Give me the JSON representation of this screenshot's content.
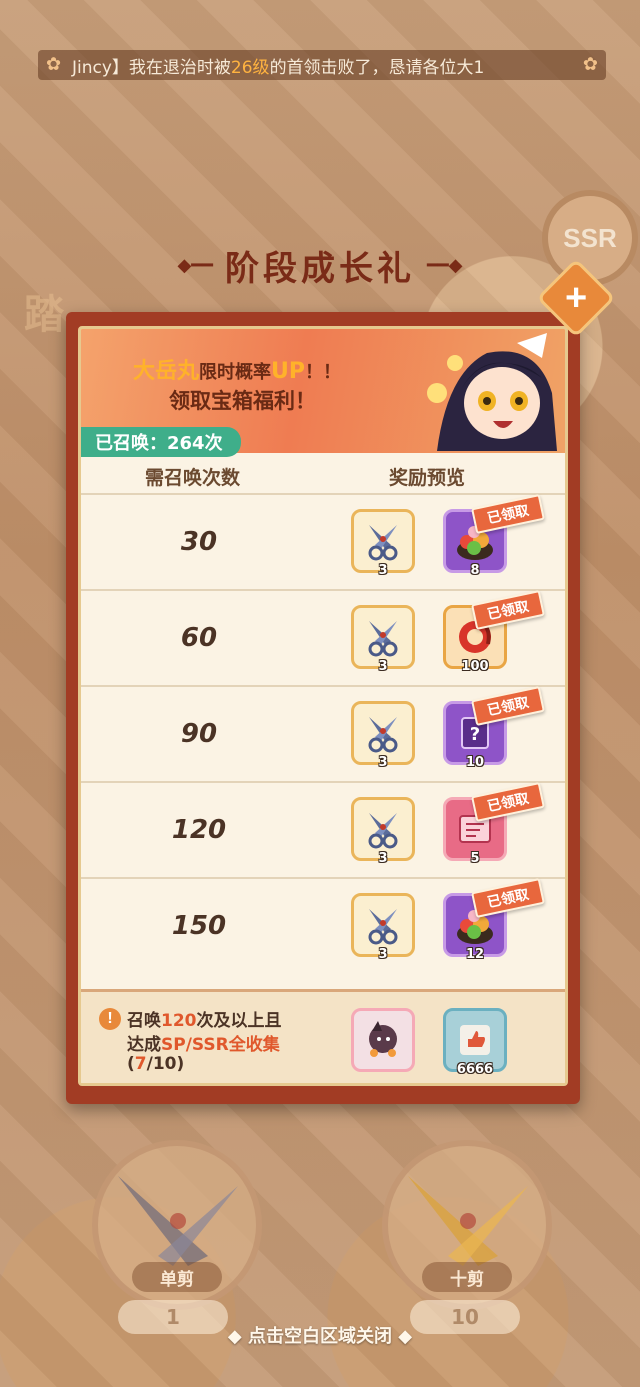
{
  "marquee": {
    "prefix": "Jincy】我在退治时被",
    "level": "26级",
    "suffix": "的首领击败了，恳请各位大1"
  },
  "background": {
    "title": "踏",
    "ssr_badge": "SSR"
  },
  "dialog": {
    "title": "阶段成长礼",
    "banner": {
      "name": "大岳丸",
      "limited_text": "限时概率",
      "up": "UP",
      "exclaim": "！！",
      "line2": "领取宝箱福利！"
    },
    "summon_count_label": "已召唤：264次",
    "columns": {
      "requirement": "需召唤次数",
      "rewards": "奖励预览"
    },
    "claimed_label": "已领取",
    "rows": [
      {
        "count": "30",
        "reward1_qty": "3",
        "reward2_qty": "8"
      },
      {
        "count": "60",
        "reward1_qty": "3",
        "reward2_qty": "100"
      },
      {
        "count": "90",
        "reward1_qty": "3",
        "reward2_qty": "10"
      },
      {
        "count": "120",
        "reward1_qty": "3",
        "reward2_qty": "5"
      },
      {
        "count": "150",
        "reward1_qty": "3",
        "reward2_qty": "12"
      }
    ],
    "bonus": {
      "line1_prefix": "召唤",
      "line1_num": "120",
      "line1_suffix": "次及以上且",
      "line2_prefix": "达成",
      "line2_hl": "SP/SSR全收集",
      "progress_open": "(",
      "progress_current": "7",
      "progress_rest": "/10)",
      "reward2_qty": "6666"
    }
  },
  "controls": {
    "single_label": "单剪",
    "single_count": "1",
    "ten_label": "十剪",
    "ten_count": "10"
  },
  "close_hint": "◆ 点击空白区域关闭 ◆",
  "colors": {
    "accent": "#e0582c",
    "panel": "#a23c24",
    "teal": "#3fae8a"
  }
}
